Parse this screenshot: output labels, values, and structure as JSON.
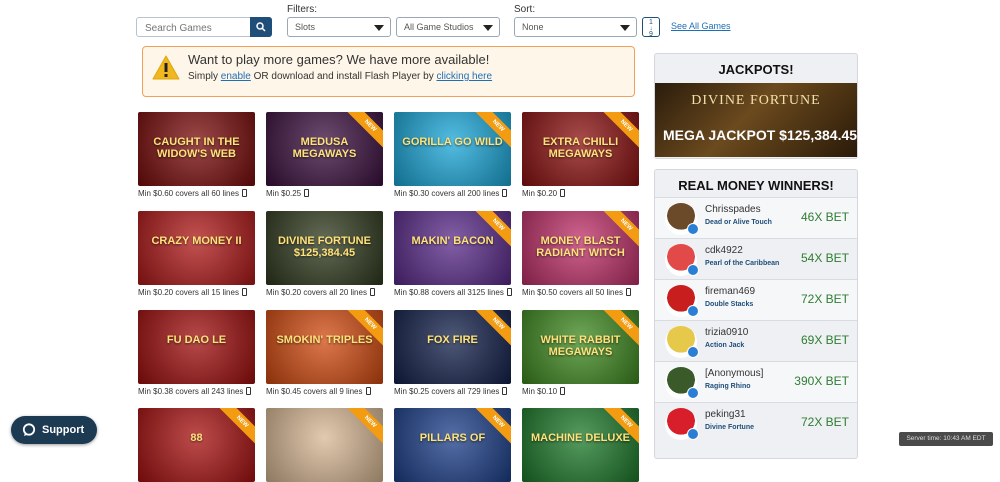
{
  "search": {
    "placeholder": "Search Games"
  },
  "filters": {
    "label": "Filters:",
    "category": "Slots",
    "studio": "All Game Studios"
  },
  "sort": {
    "label": "Sort:",
    "value": "None",
    "toggle_top": "1",
    "toggle_bottom": "9"
  },
  "see_all": "See All Games",
  "banner": {
    "title": "Want to play more games? We have more available!",
    "text1": "Simply ",
    "link1": "enable",
    "text2": " OR download and install Flash Player by ",
    "link2": "clicking here"
  },
  "ribbon_label": "NEW",
  "games": [
    {
      "name": "CAUGHT IN THE WIDOW'S WEB",
      "caption": "Min $0.60 covers all 60 lines",
      "new": false,
      "bg": "#7a0b0b"
    },
    {
      "name": "MEDUSA MEGAWAYS",
      "caption": "Min $0.25",
      "new": true,
      "bg": "#3b0f3f"
    },
    {
      "name": "GORILLA GO WILD",
      "caption": "Min $0.30 covers all 200 lines",
      "new": true,
      "bg": "#1aa7d9"
    },
    {
      "name": "EXTRA CHILLI MEGAWAYS",
      "caption": "Min $0.20",
      "new": true,
      "bg": "#8c1010"
    },
    {
      "name": "CRAZY MONEY II",
      "caption": "Min $0.20 covers all 15 lines",
      "new": false,
      "bg": "#b01818"
    },
    {
      "name": "DIVINE FORTUNE $125,384.45",
      "caption": "Min $0.20 covers all 20 lines",
      "new": false,
      "bg": "#2f3a1e"
    },
    {
      "name": "MAKIN' BACON",
      "caption": "Min $0.88 covers all 3125 lines",
      "new": true,
      "bg": "#5a2a8a"
    },
    {
      "name": "MONEY BLAST RADIANT WITCH",
      "caption": "Min $0.50 covers all 50 lines",
      "new": true,
      "bg": "#c0306a"
    },
    {
      "name": "FU DAO LE",
      "caption": "Min $0.38 covers all 243 lines",
      "new": false,
      "bg": "#a00d0d"
    },
    {
      "name": "SMOKIN' TRIPLES",
      "caption": "Min $0.45 covers all 9 lines",
      "new": true,
      "bg": "#d24a10"
    },
    {
      "name": "FOX FIRE",
      "caption": "Min $0.25 covers all 729 lines",
      "new": true,
      "bg": "#12204a"
    },
    {
      "name": "WHITE RABBIT MEGAWAYS",
      "caption": "Min $0.10",
      "new": true,
      "bg": "#3f8a20"
    },
    {
      "name": "88",
      "caption": "",
      "new": true,
      "bg": "#a81010"
    },
    {
      "name": "",
      "caption": "",
      "new": true,
      "bg": "#d8b894"
    },
    {
      "name": "PILLARS OF",
      "caption": "",
      "new": true,
      "bg": "#1c3f8a"
    },
    {
      "name": "MACHINE DELUXE",
      "caption": "",
      "new": true,
      "bg": "#1d7a2a"
    }
  ],
  "jackpots": {
    "title": "JACKPOTS!",
    "game": "DIVINE FORTUNE",
    "label": "MEGA JACKPOT",
    "amount": "$125,384.45"
  },
  "winners": {
    "title": "REAL MONEY WINNERS!",
    "items": [
      {
        "name": "Chrisspades",
        "game": "Dead or Alive Touch",
        "bet": "46X BET",
        "color": "#6b4a2a"
      },
      {
        "name": "cdk4922",
        "game": "Pearl of the Caribbean",
        "bet": "54X BET",
        "color": "#e24a4a"
      },
      {
        "name": "fireman469",
        "game": "Double Stacks",
        "bet": "72X BET",
        "color": "#c81e1e"
      },
      {
        "name": "trizia0910",
        "game": "Action Jack",
        "bet": "69X BET",
        "color": "#e6c84a"
      },
      {
        "name": "[Anonymous]",
        "game": "Raging Rhino",
        "bet": "390X BET",
        "color": "#3a5a2a"
      },
      {
        "name": "peking31",
        "game": "Divine Fortune",
        "bet": "72X BET",
        "color": "#d81e2a"
      }
    ]
  },
  "support": {
    "label": "Support"
  },
  "server_time": "Server time: 10:43 AM EDT"
}
